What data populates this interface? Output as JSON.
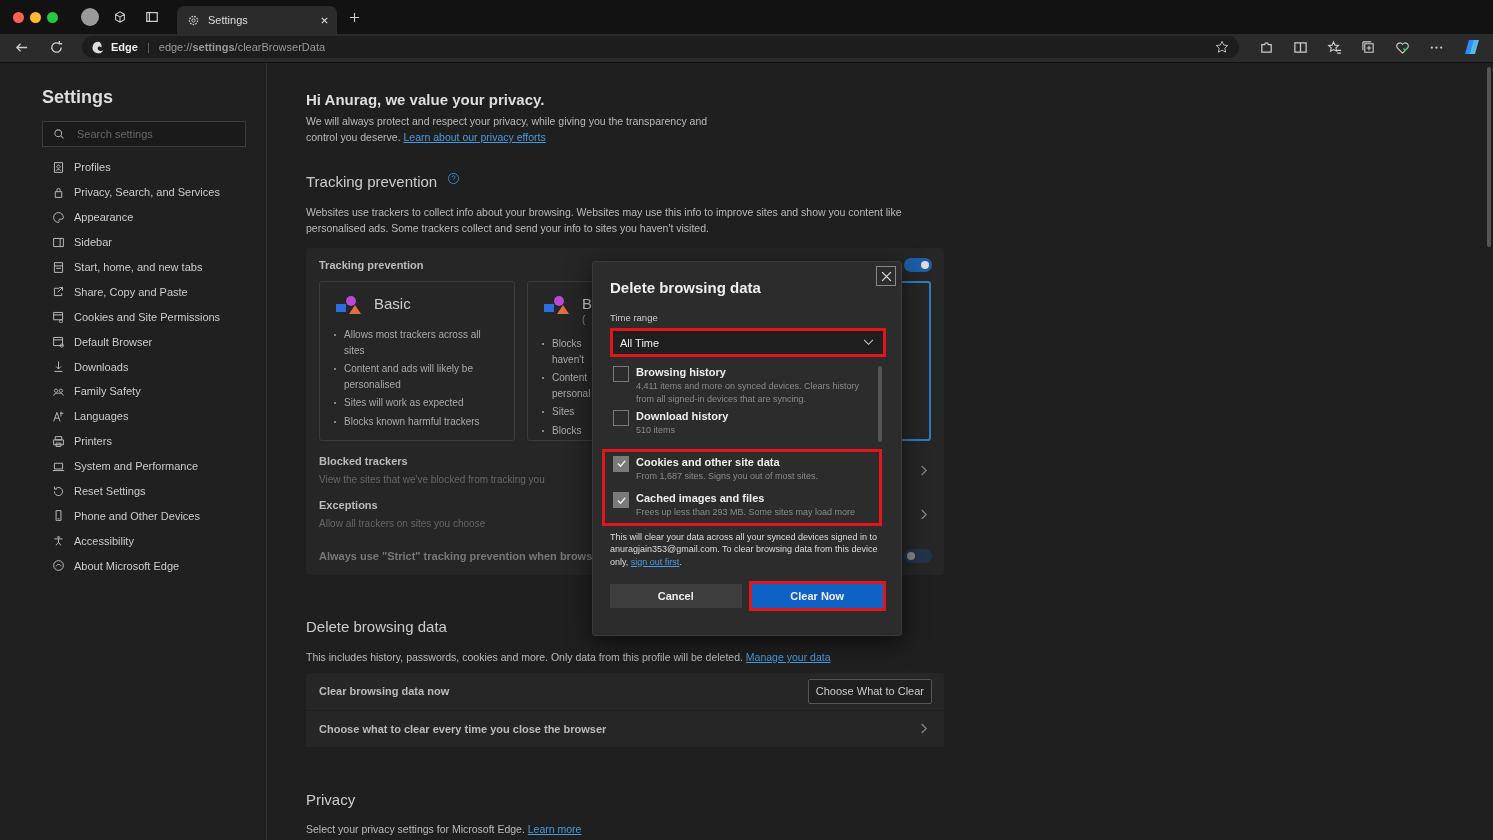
{
  "browser": {
    "tabs": [
      {
        "label": "Settings",
        "selected": true
      }
    ],
    "address": {
      "site": "Edge",
      "separator": "|",
      "url": "edge://**settings**/clearBrowserData"
    }
  },
  "sidebar": {
    "title": "Settings",
    "search": {
      "placeholder": "Search settings"
    },
    "items": [
      {
        "label": "Profiles"
      },
      {
        "label": "Privacy, Search, and Services"
      },
      {
        "label": "Appearance"
      },
      {
        "label": "Sidebar"
      },
      {
        "label": "Start, home, and new tabs"
      },
      {
        "label": "Share, Copy and Paste"
      },
      {
        "label": "Cookies and Site Permissions"
      },
      {
        "label": "Default Browser"
      },
      {
        "label": "Downloads"
      },
      {
        "label": "Family Safety"
      },
      {
        "label": "Languages"
      },
      {
        "label": "Printers"
      },
      {
        "label": "System and Performance"
      },
      {
        "label": "Reset Settings"
      },
      {
        "label": "Phone and Other Devices"
      },
      {
        "label": "Accessibility"
      },
      {
        "label": "About Microsoft Edge"
      }
    ]
  },
  "intro": {
    "heading": "Hi Anurag, we value your privacy.",
    "text": "We will always protect and respect your privacy, while giving you the transparency and control you deserve.",
    "link": "Learn about our privacy efforts"
  },
  "tracking": {
    "heading": "Tracking prevention",
    "description": "Websites use trackers to collect info about your browsing. Websites may use this info to improve sites and show you content like personalised ads. Some trackers collect and send your info to sites you haven't visited.",
    "panel": {
      "title": "Tracking prevention",
      "on": true,
      "cards": [
        {
          "title": "Basic",
          "bullets": [
            "Allows most trackers across all sites",
            "Content and ads will likely be personalised",
            "Sites will work as expected",
            "Blocks known harmful trackers"
          ],
          "selected": false
        },
        {
          "title": "B",
          "subtitle": "(",
          "bullets": [
            "Blocks\nhaven't",
            "Content\npersonal",
            "Sites",
            "Blocks"
          ],
          "selected": false
        },
        {
          "selected": true
        }
      ],
      "rows": [
        {
          "title": "Blocked trackers",
          "subtitle": "View the sites that we've blocked from tracking you"
        },
        {
          "title": "Exceptions",
          "subtitle": "Allow all trackers on sites you choose"
        }
      ],
      "strict": {
        "label": "Always use \"Strict\" tracking prevention when brows",
        "on": false
      }
    }
  },
  "delete": {
    "heading": "Delete browsing data",
    "text": "This includes history, passwords, cookies and more. Only data from this profile will be deleted.",
    "link": "Manage your data",
    "rows": [
      {
        "label": "Clear browsing data now",
        "button": "Choose What to Clear"
      },
      {
        "label": "Choose what to clear every time you close the browser"
      }
    ]
  },
  "privacy": {
    "heading": "Privacy",
    "text": "Select your privacy settings for Microsoft Edge.",
    "link": "Learn more"
  },
  "dialog": {
    "title": "Delete browsing data",
    "time_range": {
      "label": "Time range",
      "value": "All Time",
      "highlighted": true
    },
    "items": [
      {
        "title": "Browsing history",
        "description": "4,411 items and more on synced devices. Clears history from all signed-in devices that are syncing.",
        "checked": false,
        "highlighted": false
      },
      {
        "title": "Download history",
        "description": "510 items",
        "checked": false,
        "highlighted": false
      },
      {
        "title": "Cookies and other site data",
        "description": "From 1,687 sites. Signs you out of most sites.",
        "checked": true,
        "highlighted": true
      },
      {
        "title": "Cached images and files",
        "description": "Frees up less than 293 MB. Some sites may load more",
        "checked": true,
        "highlighted": true
      }
    ],
    "note": "This will clear your data across all your synced devices signed in to anuragjain353@gmail.com. To clear browsing data from this device only,",
    "note_link": "sign out first",
    "note_end": ".",
    "buttons": [
      {
        "label": "Cancel",
        "kind": "secondary",
        "highlighted": false
      },
      {
        "label": "Clear Now",
        "kind": "primary",
        "highlighted": true
      }
    ]
  }
}
